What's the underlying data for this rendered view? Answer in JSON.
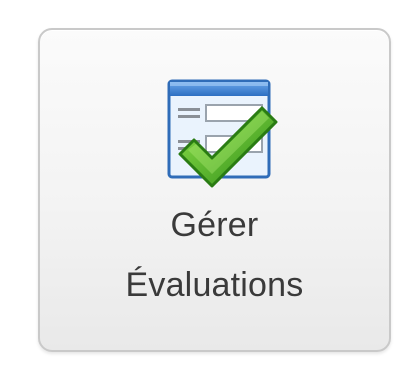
{
  "button": {
    "line1": "Gérer",
    "line2": "Évaluations",
    "icon": "form-checkmark-icon"
  },
  "colors": {
    "icon_header": "#3f7fd0",
    "icon_border": "#2f6cb8",
    "check_green": "#55b52a",
    "text": "#3a3a3a"
  }
}
